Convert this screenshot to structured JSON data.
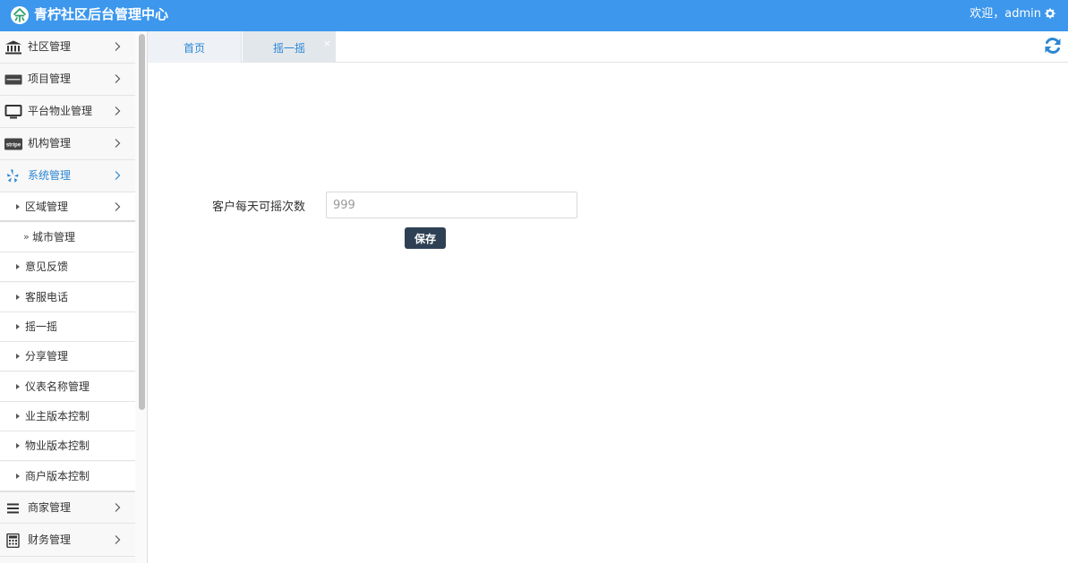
{
  "app": {
    "title": "青柠社区后台管理中心",
    "welcome": "欢迎，admin",
    "logo_icon": "leaf-logo-icon",
    "brand_color": "#3c97ed"
  },
  "sidebar": {
    "menu": [
      {
        "label": "社区管理",
        "icon": "bank-icon"
      },
      {
        "label": "项目管理",
        "icon": "card-icon"
      },
      {
        "label": "平台物业管理",
        "icon": "monitor-icon"
      },
      {
        "label": "机构管理",
        "icon": "stripe-icon",
        "icon_text": "stripe"
      },
      {
        "label": "系统管理",
        "icon": "yelp-icon",
        "active": true
      }
    ],
    "submenu": [
      {
        "label": "区域管理",
        "expanded": true
      },
      {
        "label": "城市管理",
        "level": 2
      },
      {
        "label": "意见反馈"
      },
      {
        "label": "客服电话"
      },
      {
        "label": "摇一摇"
      },
      {
        "label": "分享管理"
      },
      {
        "label": "仪表名称管理"
      },
      {
        "label": "业主版本控制"
      },
      {
        "label": "物业版本控制"
      },
      {
        "label": "商户版本控制"
      }
    ],
    "menu_bottom": [
      {
        "label": "商家管理",
        "icon": "bars-icon"
      },
      {
        "label": "财务管理",
        "icon": "calculator-icon"
      }
    ]
  },
  "tabs": [
    {
      "label": "首页"
    },
    {
      "label": "摇一摇",
      "active": true,
      "close": "×"
    }
  ],
  "form": {
    "label": "客户每天可摇次数",
    "value": "999",
    "save_label": "保存"
  }
}
